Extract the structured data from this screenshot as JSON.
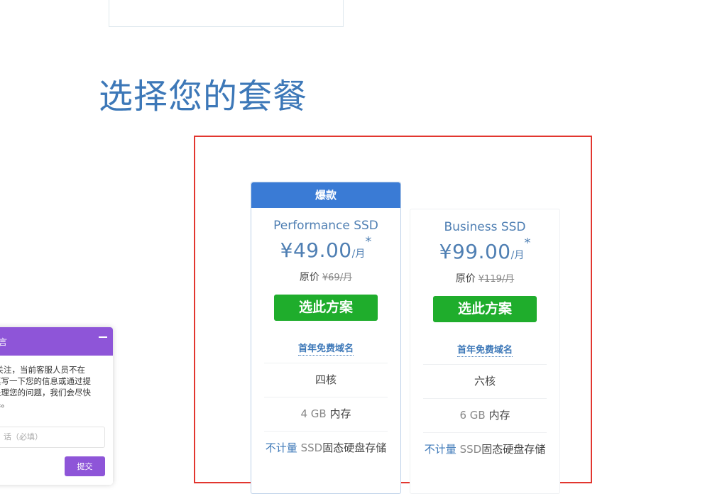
{
  "heading": "选择您的套餐",
  "plans": [
    {
      "badge": "爆款",
      "name": "Performance SSD",
      "price": "¥49.00",
      "unit": "/月",
      "star": "*",
      "original_label": "原价",
      "original_price": "¥69/月",
      "cta": "选此方案",
      "domain_offer": "首年免费域名",
      "cores": "四核",
      "ram_value": "4 GB",
      "ram_label": "内存",
      "storage_prefix": "不计量",
      "storage_ssd": "SSD",
      "storage_label": "固态硬盘存储"
    },
    {
      "name": "Business SSD",
      "price": "¥99.00",
      "unit": "/月",
      "star": "*",
      "original_label": "原价",
      "original_price": "¥119/月",
      "cta": "选此方案",
      "domain_offer": "首年免费域名",
      "cores": "六核",
      "ram_value": "6 GB",
      "ram_label": "内存",
      "storage_prefix": "不计量",
      "storage_ssd": "SSD",
      "storage_label": "固态硬盘存储"
    }
  ],
  "chat": {
    "title": "言",
    "message": "的关注，当前客服人员不在\n真写一下您的信息或通过提\n处理您的问题，我们会尽快\n系。",
    "input_placeholder": "话（必填）",
    "submit": "提交"
  },
  "colors": {
    "heading": "#3d78b8",
    "ribbon": "#3a7bd5",
    "cta": "#1fad2c",
    "chat": "#8e55d8",
    "frame": "#e2362f"
  }
}
